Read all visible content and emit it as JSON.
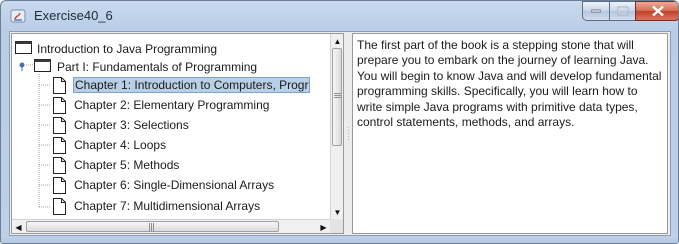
{
  "window": {
    "title": "Exercise40_6"
  },
  "tree": {
    "root": "Introduction to Java Programming",
    "part": "Part I: Fundamentals of Programming",
    "chapters": [
      "Chapter 1: Introduction to Computers, Progr",
      "Chapter 2: Elementary Programming",
      "Chapter 3: Selections",
      "Chapter 4: Loops",
      "Chapter 5: Methods",
      "Chapter 6: Single-Dimensional Arrays",
      "Chapter 7: Multidimensional Arrays"
    ],
    "selected_index": 0
  },
  "description": "The first part of the book is a stepping stone that will prepare you to embark on the journey of learning Java. You will begin to know Java and will develop fundamental programming skills. Specifically, you will learn how to write simple Java programs with primitive data types, control statements, methods, and arrays.",
  "colors": {
    "selection_bg": "#b8cfe5",
    "selection_border": "#7aa3cf",
    "close_button": "#c2412a"
  }
}
